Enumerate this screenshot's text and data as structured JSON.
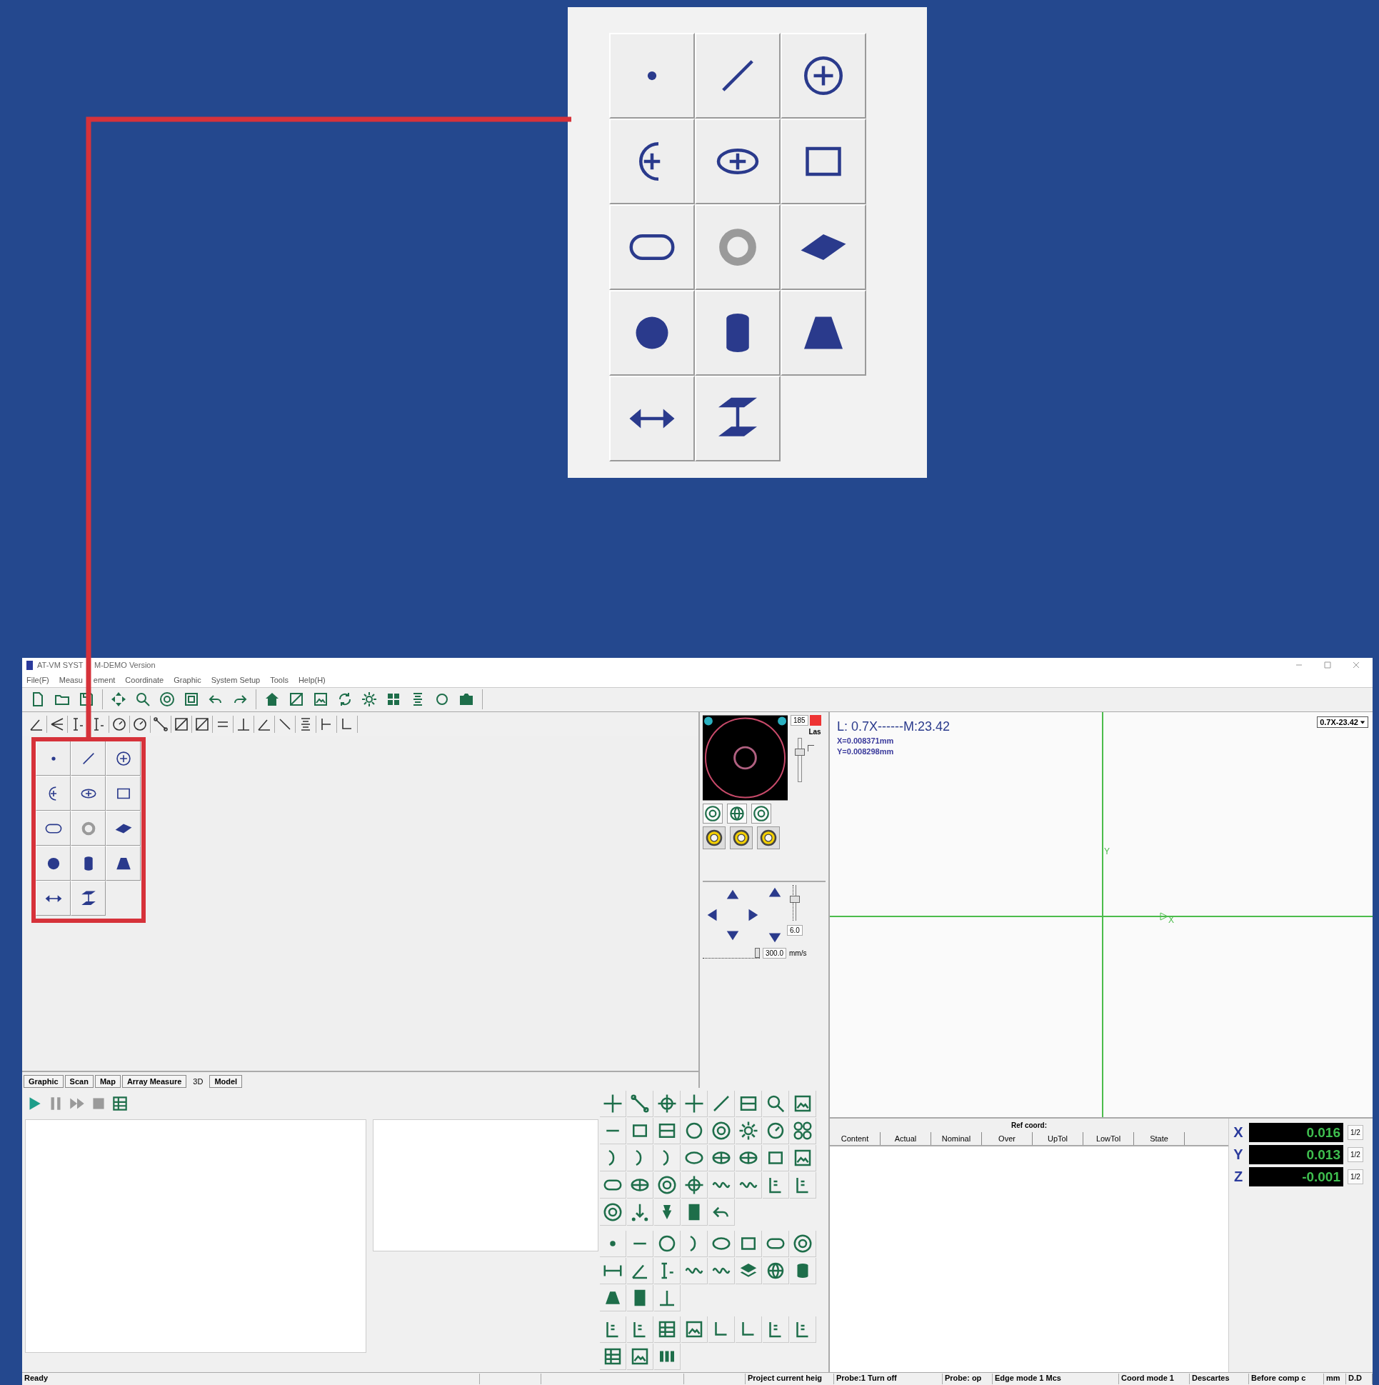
{
  "window": {
    "title_parts": [
      "AT-VM SYST",
      "M-DEMO Version"
    ]
  },
  "menu": [
    {
      "label": "File(F)"
    },
    {
      "label_parts": [
        "Measu",
        "ement"
      ]
    },
    {
      "label": "Coordinate"
    },
    {
      "label": "Graphic"
    },
    {
      "label": "System Setup"
    },
    {
      "label": "Tools"
    },
    {
      "label": "Help(H)"
    }
  ],
  "view_tabs": [
    {
      "label": "Graphic",
      "selected": false
    },
    {
      "label": "Scan",
      "selected": false
    },
    {
      "label": "Map",
      "selected": false
    },
    {
      "label": "Array Measure",
      "selected": false
    },
    {
      "label": "3D",
      "selected": true
    },
    {
      "label": "Model",
      "selected": false
    }
  ],
  "camera": {
    "zoom_field": "185",
    "light_label": "Las",
    "light_slider": {
      "level": 0.7
    },
    "light_checked": false,
    "step_slider": {
      "level": 0.6
    },
    "speed_slider": {
      "level": 1.0
    },
    "step_field": "6.0",
    "speed_field": "300.0",
    "speed_unit": "mm/s"
  },
  "graphic": {
    "lens_info": "L: 0.7X------M:23.42",
    "x_offset": "X=0.008371mm",
    "y_offset": "Y=0.008298mm",
    "lens_select": "0.7X-23.42",
    "axis_y": "Y",
    "axis_x": "X"
  },
  "results": {
    "title": "Ref coord:",
    "columns": [
      "Content",
      "Actual",
      "Nominal",
      "Over",
      "UpTol",
      "LowTol",
      "State"
    ]
  },
  "readouts": [
    {
      "axis": "X",
      "value": "0.016",
      "ratio": "1/2"
    },
    {
      "axis": "Y",
      "value": "0.013",
      "ratio": "1/2"
    },
    {
      "axis": "Z",
      "value": "-0.001",
      "ratio": "1/2"
    }
  ],
  "status_bar": [
    {
      "text": "Ready"
    },
    {
      "text": "Project current heig"
    },
    {
      "text": "Probe:1 Turn off"
    },
    {
      "text": "Probe: op"
    },
    {
      "text": "Edge mode 1 Mcs"
    },
    {
      "text": "Coord mode 1"
    },
    {
      "text": "Descartes"
    },
    {
      "text": "Before comp c"
    },
    {
      "text": "mm"
    },
    {
      "text": "D.D"
    }
  ]
}
